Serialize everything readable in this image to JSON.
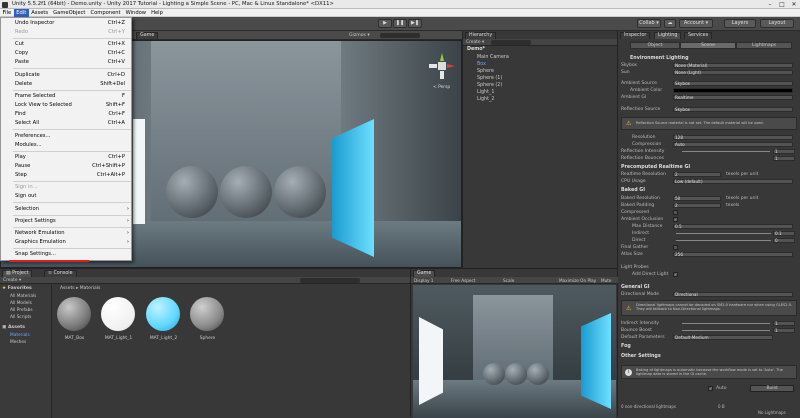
{
  "window": {
    "title": "Unity 5.5.2f1 (64bit) - Demo.unity - Unity 2017 Tutorial - Lighting a Simple Scene - PC, Mac & Linux Standalone* <DX11>"
  },
  "menubar": {
    "items": [
      "File",
      "Edit",
      "Assets",
      "GameObject",
      "Component",
      "Window",
      "Help"
    ]
  },
  "edit_menu": {
    "items": [
      {
        "label": "Undo Inspector",
        "shortcut": "Ctrl+Z"
      },
      {
        "label": "Redo",
        "shortcut": "Ctrl+Y",
        "disabled": true
      },
      {
        "label": "Cut",
        "shortcut": "Ctrl+X"
      },
      {
        "label": "Copy",
        "shortcut": "Ctrl+C"
      },
      {
        "label": "Paste",
        "shortcut": "Ctrl+V"
      },
      {
        "label": "Duplicate",
        "shortcut": "Ctrl+D"
      },
      {
        "label": "Delete",
        "shortcut": "Shift+Del"
      },
      {
        "label": "Frame Selected",
        "shortcut": "F"
      },
      {
        "label": "Lock View to Selected",
        "shortcut": "Shift+F"
      },
      {
        "label": "Find",
        "shortcut": "Ctrl+F"
      },
      {
        "label": "Select All",
        "shortcut": "Ctrl+A"
      },
      {
        "label": "Preferences...",
        "shortcut": ""
      },
      {
        "label": "Modules...",
        "shortcut": ""
      },
      {
        "label": "Play",
        "shortcut": "Ctrl+P"
      },
      {
        "label": "Pause",
        "shortcut": "Ctrl+Shift+P"
      },
      {
        "label": "Step",
        "shortcut": "Ctrl+Alt+P"
      },
      {
        "label": "Sign in...",
        "shortcut": "",
        "disabled": true
      },
      {
        "label": "Sign out",
        "shortcut": ""
      },
      {
        "label": "Selection",
        "shortcut": ""
      },
      {
        "label": "Project Settings",
        "shortcut": ""
      },
      {
        "label": "Network Emulation",
        "shortcut": ""
      },
      {
        "label": "Graphics Emulation",
        "shortcut": ""
      },
      {
        "label": "Snap Settings...",
        "shortcut": ""
      }
    ]
  },
  "toolbar": {
    "collab": "Collab ▾",
    "account": "Account ▾",
    "layers": "Layers",
    "layout": "Layout"
  },
  "scene": {
    "tab_game": "Game",
    "gizmos": "Gizmos ▾",
    "persp": "< Persp"
  },
  "hierarchy": {
    "tab": "Hierarchy",
    "create": "Create ▾",
    "scene_name": "Demo*",
    "items": [
      "Main Camera",
      "Box",
      "Sphere",
      "Sphere (1)",
      "Sphere (2)",
      "Light_1",
      "Light_2"
    ]
  },
  "inspector": {
    "tabs": [
      "Inspector",
      "Lighting",
      "Services"
    ],
    "subtabs": [
      "Object",
      "Scene",
      "Lightmaps"
    ],
    "env_lighting": "Environment Lighting",
    "rows": [
      {
        "label": "Skybox",
        "value": "None (Material)"
      },
      {
        "label": "Sun",
        "value": "None (Light)"
      },
      {
        "label": "Ambient Source",
        "value": "Skybox"
      },
      {
        "label": "Ambient Color",
        "value": ""
      },
      {
        "label": "Ambient GI",
        "value": "Realtime"
      },
      {
        "label": "Reflection Source",
        "value": "Skybox"
      }
    ],
    "warning": "Reflection Source material is not set. The default material will be used.",
    "rows2": [
      {
        "label": "Resolution",
        "value": "128"
      },
      {
        "label": "Compression",
        "value": "Auto"
      },
      {
        "label": "Reflection Intensity",
        "value": "1"
      },
      {
        "label": "Reflection Bounces",
        "value": "1"
      }
    ],
    "precomputed": "Precomputed Realtime GI",
    "rows3": [
      {
        "label": "Realtime Resolution",
        "value": "2"
      },
      {
        "label": "CPU Usage",
        "value": "Low (default)"
      }
    ],
    "baked": "Baked GI",
    "rows4": [
      {
        "label": "Baked Resolution",
        "value": "50"
      },
      {
        "label": "Baked Padding",
        "value": "2"
      },
      {
        "label": "Compressed",
        "value": ""
      },
      {
        "label": "Ambient Occlusion",
        "value": ""
      },
      {
        "label": "Max Distance",
        "value": "0.5"
      },
      {
        "label": "Indirect",
        "value": "0.1"
      },
      {
        "label": "Direct",
        "value": "0"
      },
      {
        "label": "Final Gather",
        "value": ""
      },
      {
        "label": "Atlas Size",
        "value": "256"
      }
    ],
    "texels": "texels per unit",
    "texels2": "texels",
    "light_probes": "Light Probes",
    "add_direct": "Add Direct Light",
    "general_gi": "General GI",
    "dir_mode": {
      "label": "Directional Mode",
      "value": "Directional"
    },
    "gi_warning": "Directional lightmaps cannot be decoded on SM2.0 hardware nor when using GLES2.0. They will fallback to Non-Directional lightmaps.",
    "rows5": [
      {
        "label": "Indirect Intensity",
        "value": "1"
      },
      {
        "label": "Bounce Boost",
        "value": "1"
      },
      {
        "label": "Default Parameters",
        "value": "Default-Medium"
      }
    ],
    "fog": "Fog",
    "other": "Other Settings",
    "baking_msg": "Baking of lightmaps is automatic because the workflow mode is set to 'Auto'. The lightmap data is stored in the GI cache.",
    "auto": "Auto",
    "build": "Build",
    "footer_left": "0 non-directional lightmaps",
    "footer_mid": "0 B",
    "footer_right": "No Lightmaps"
  },
  "project": {
    "tab": "Project",
    "tab2": "Console",
    "create": "Create ▾",
    "favorites": "Favorites",
    "fav_items": [
      "All Materials",
      "All Models",
      "All Prefabs",
      "All Scripts"
    ],
    "assets": "Assets",
    "asset_items": [
      "Materials",
      "Meshes"
    ],
    "breadcrumb": "Assets ▸ Materials",
    "materials": [
      {
        "name": "MAT_Box",
        "color": "#8a8a8a"
      },
      {
        "name": "MAT_Light_1",
        "color": "#ffffff"
      },
      {
        "name": "MAT_Light_2",
        "color": "#5fd7ff"
      },
      {
        "name": "Sphere",
        "color": "#9a9a9a"
      }
    ]
  },
  "game": {
    "tab": "Game",
    "display": "Display 1",
    "aspect": "Free Aspect",
    "scale": "Scale",
    "maximize": "Maximize On Play",
    "mute": "Mute"
  }
}
